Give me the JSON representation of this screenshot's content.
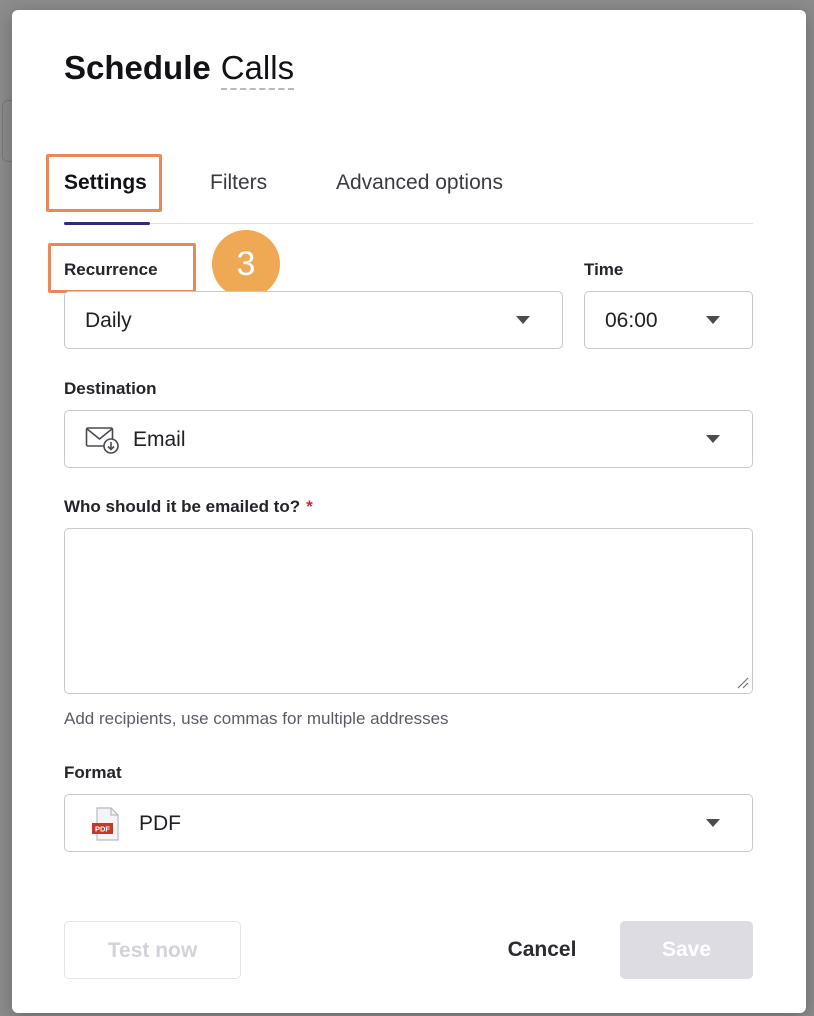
{
  "dialog": {
    "title_strong": "Schedule",
    "title_name": "Calls"
  },
  "tabs": [
    {
      "label": "Settings",
      "active": true
    },
    {
      "label": "Filters",
      "active": false
    },
    {
      "label": "Advanced options",
      "active": false
    }
  ],
  "annotation": {
    "step_number": "3",
    "highlight_color": "#e8895a",
    "badge_color": "#efa955"
  },
  "recurrence": {
    "label": "Recurrence",
    "value": "Daily"
  },
  "time": {
    "label": "Time",
    "value": "06:00"
  },
  "destination": {
    "label": "Destination",
    "value": "Email",
    "icon": "email-icon"
  },
  "recipients": {
    "label": "Who should it be emailed to?",
    "required_mark": "*",
    "value": "",
    "helper": "Add recipients, use commas for multiple addresses"
  },
  "format": {
    "label": "Format",
    "value": "PDF",
    "icon": "pdf-file-icon",
    "icon_text": "PDF"
  },
  "footer": {
    "test_label": "Test now",
    "cancel_label": "Cancel",
    "save_label": "Save"
  },
  "colors": {
    "tab_indicator": "#2f2a7a",
    "required": "#d0243a",
    "disabled_button": "#dcdce2"
  }
}
